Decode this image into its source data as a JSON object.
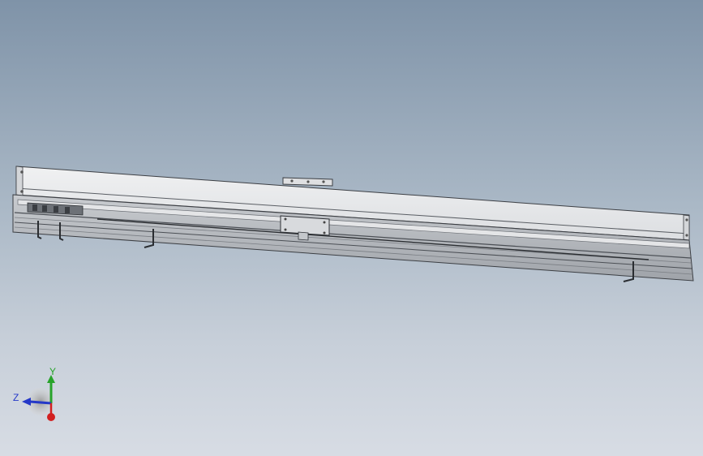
{
  "viewport": {
    "background_top": "#7f93a8",
    "background_bottom": "#d7dce4"
  },
  "model": {
    "body_color": "#e6e7e9",
    "edge_color": "#3c3f44",
    "shade_color": "#b9bcc1"
  },
  "triad": {
    "y_label": "Y",
    "z_label": "Z",
    "y_color": "#27a32a",
    "z_color": "#2438c8",
    "x_color": "#d22020"
  }
}
